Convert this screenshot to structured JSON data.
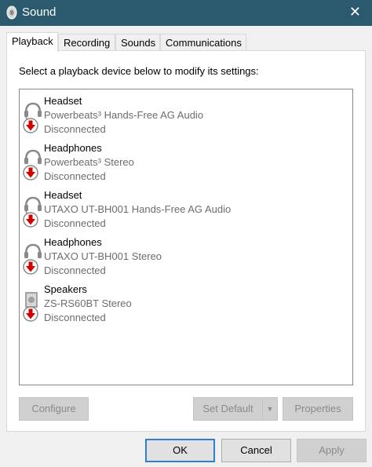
{
  "window": {
    "title": "Sound",
    "close_glyph": "✕"
  },
  "tabs": [
    {
      "label": "Playback",
      "active": true
    },
    {
      "label": "Recording",
      "active": false
    },
    {
      "label": "Sounds",
      "active": false
    },
    {
      "label": "Communications",
      "active": false
    }
  ],
  "panel": {
    "instruction": "Select a playback device below to modify its settings:"
  },
  "devices": [
    {
      "name": "Headset",
      "description": "Powerbeats³ Hands-Free AG Audio",
      "status": "Disconnected",
      "icon": "headset-icon"
    },
    {
      "name": "Headphones",
      "description": "Powerbeats³ Stereo",
      "status": "Disconnected",
      "icon": "headphones-icon"
    },
    {
      "name": "Headset",
      "description": "UTAXO UT-BH001 Hands-Free AG Audio",
      "status": "Disconnected",
      "icon": "headset-icon"
    },
    {
      "name": "Headphones",
      "description": "UTAXO UT-BH001 Stereo",
      "status": "Disconnected",
      "icon": "headphones-icon"
    },
    {
      "name": "Speakers",
      "description": "ZS-RS60BT Stereo",
      "status": "Disconnected",
      "icon": "speaker-icon"
    }
  ],
  "panel_buttons": {
    "configure": "Configure",
    "set_default": "Set Default",
    "set_default_arrow": "▼",
    "properties": "Properties"
  },
  "dialog_buttons": {
    "ok": "OK",
    "cancel": "Cancel",
    "apply": "Apply"
  },
  "colors": {
    "titlebar": "#2b5a6e",
    "disconnected_badge": "#d40000",
    "default_button_border": "#2f7fd1"
  }
}
